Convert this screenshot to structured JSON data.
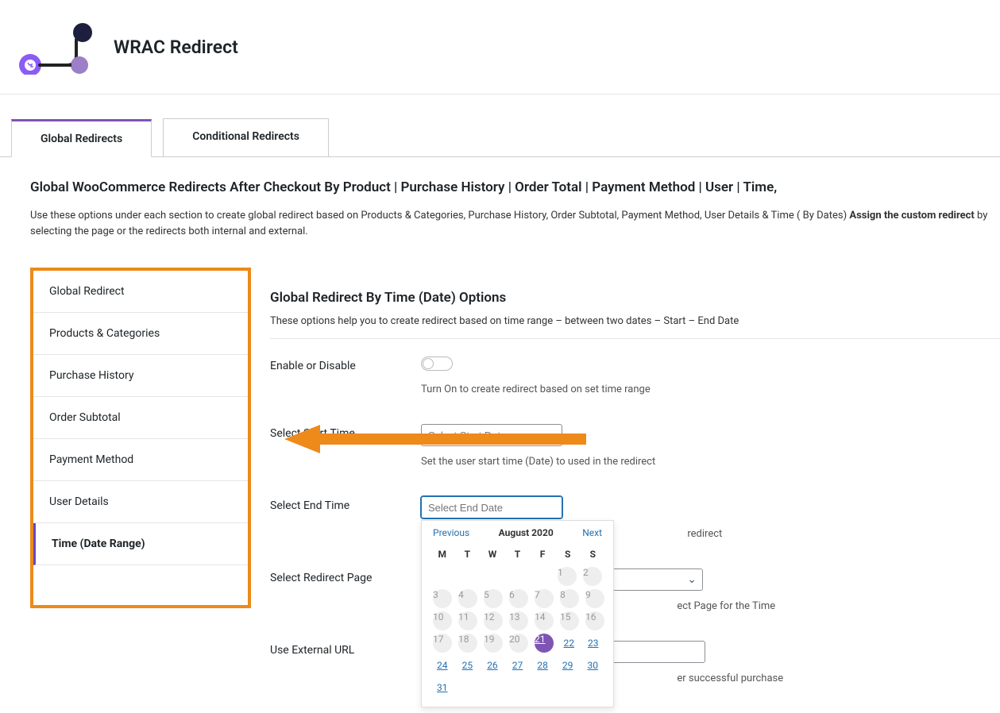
{
  "header": {
    "title": "WRAC Redirect"
  },
  "tabs": [
    {
      "label": "Global Redirects",
      "active": true
    },
    {
      "label": "Conditional Redirects",
      "active": false
    }
  ],
  "page": {
    "title": "Global WooCommerce Redirects After Checkout By Product | Purchase History | Order Total | Payment Method | User | Time,",
    "desc_a": "Use these options under each section to create global redirect based on Products & Categories, Purchase History, Order Subtotal, Payment Method, User Details & Time ( By Dates) ",
    "desc_bold": "Assign the custom redirect",
    "desc_b": " by selecting the page or the redirects both internal and external."
  },
  "sidebar": {
    "items": [
      {
        "label": "Global Redirect"
      },
      {
        "label": "Products & Categories"
      },
      {
        "label": "Purchase History"
      },
      {
        "label": "Order Subtotal"
      },
      {
        "label": "Payment Method"
      },
      {
        "label": "User Details"
      },
      {
        "label": "Time (Date Range)"
      }
    ],
    "active_index": 6
  },
  "section": {
    "title": "Global Redirect By Time (Date) Options",
    "subtitle": "These options help you to create redirect based on time range – between two dates – Start – End Date"
  },
  "fields": {
    "enable": {
      "label": "Enable or Disable",
      "help": "Turn On to create redirect based on set time range"
    },
    "start": {
      "label": "Select Start Time",
      "placeholder": "Select Start Date",
      "help": "Set the user start time (Date) to used in the redirect"
    },
    "end": {
      "label": "Select End Time",
      "placeholder": "Select End Date",
      "help_fragment": "redirect"
    },
    "page": {
      "label": "Select Redirect Page",
      "help_fragment": "ect Page for the Time"
    },
    "ext": {
      "label": "Use External URL",
      "help_fragment": "er successful purchase"
    }
  },
  "datepicker": {
    "prev": "Previous",
    "next": "Next",
    "month": "August 2020",
    "dow": [
      "M",
      "T",
      "W",
      "T",
      "F",
      "S",
      "S"
    ],
    "weeks": [
      [
        {
          "n": "",
          "t": "empty"
        },
        {
          "n": "",
          "t": "empty"
        },
        {
          "n": "",
          "t": "empty"
        },
        {
          "n": "",
          "t": "empty"
        },
        {
          "n": "",
          "t": "empty"
        },
        {
          "n": "1",
          "t": "muted"
        },
        {
          "n": "2",
          "t": "muted"
        }
      ],
      [
        {
          "n": "3",
          "t": "muted"
        },
        {
          "n": "4",
          "t": "muted"
        },
        {
          "n": "5",
          "t": "muted"
        },
        {
          "n": "6",
          "t": "muted"
        },
        {
          "n": "7",
          "t": "muted"
        },
        {
          "n": "8",
          "t": "muted"
        },
        {
          "n": "9",
          "t": "muted"
        }
      ],
      [
        {
          "n": "10",
          "t": "muted"
        },
        {
          "n": "11",
          "t": "muted"
        },
        {
          "n": "12",
          "t": "muted"
        },
        {
          "n": "13",
          "t": "muted"
        },
        {
          "n": "14",
          "t": "muted"
        },
        {
          "n": "15",
          "t": "muted"
        },
        {
          "n": "16",
          "t": "muted"
        }
      ],
      [
        {
          "n": "17",
          "t": "muted"
        },
        {
          "n": "18",
          "t": "muted"
        },
        {
          "n": "19",
          "t": "muted"
        },
        {
          "n": "20",
          "t": "muted"
        },
        {
          "n": "21",
          "t": "selected"
        },
        {
          "n": "22",
          "t": "link"
        },
        {
          "n": "23",
          "t": "link"
        }
      ],
      [
        {
          "n": "24",
          "t": "link"
        },
        {
          "n": "25",
          "t": "link"
        },
        {
          "n": "26",
          "t": "link"
        },
        {
          "n": "27",
          "t": "link"
        },
        {
          "n": "28",
          "t": "link"
        },
        {
          "n": "29",
          "t": "link"
        },
        {
          "n": "30",
          "t": "link"
        }
      ],
      [
        {
          "n": "31",
          "t": "link"
        },
        {
          "n": "",
          "t": "empty"
        },
        {
          "n": "",
          "t": "empty"
        },
        {
          "n": "",
          "t": "empty"
        },
        {
          "n": "",
          "t": "empty"
        },
        {
          "n": "",
          "t": "empty"
        },
        {
          "n": "",
          "t": "empty"
        }
      ]
    ]
  }
}
